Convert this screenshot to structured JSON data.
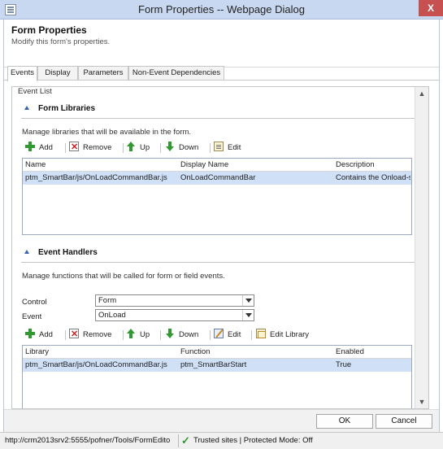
{
  "window": {
    "title": "Form Properties -- Webpage Dialog",
    "close_label": "X"
  },
  "header": {
    "title": "Form Properties",
    "subtitle": "Modify this form's properties."
  },
  "tabs": [
    {
      "label": "Events",
      "active": true
    },
    {
      "label": "Display",
      "active": false
    },
    {
      "label": "Parameters",
      "active": false
    },
    {
      "label": "Non-Event Dependencies",
      "active": false
    }
  ],
  "event_list": {
    "legend": "Event List",
    "form_libraries": {
      "title": "Form Libraries",
      "description": "Manage libraries that will be available in the form.",
      "toolbar": {
        "add": "Add",
        "remove": "Remove",
        "up": "Up",
        "down": "Down",
        "edit": "Edit"
      },
      "columns": [
        "Name",
        "Display Name",
        "Description"
      ],
      "rows": [
        {
          "name": "ptm_SmartBar/js/OnLoadCommandBar.js",
          "display_name": "OnLoadCommandBar",
          "description": "Contains the Onload-s..."
        }
      ]
    },
    "event_handlers": {
      "title": "Event Handlers",
      "description": "Manage functions that will be called for form or field events.",
      "control_label": "Control",
      "control_value": "Form",
      "event_label": "Event",
      "event_value": "OnLoad",
      "toolbar": {
        "add": "Add",
        "remove": "Remove",
        "up": "Up",
        "down": "Down",
        "edit": "Edit",
        "edit_library": "Edit Library"
      },
      "columns": [
        "Library",
        "Function",
        "Enabled"
      ],
      "rows": [
        {
          "library": "ptm_SmartBar/js/OnLoadCommandBar.js",
          "function": "ptm_SmartBarStart",
          "enabled": "True"
        }
      ]
    }
  },
  "footer": {
    "ok": "OK",
    "cancel": "Cancel"
  },
  "statusbar": {
    "url": "http://crm2013srv2:5555/pofner/Tools/FormEdito",
    "zone": "Trusted sites | Protected Mode: Off"
  },
  "colors": {
    "titlebar": "#c9d8f1",
    "close": "#c75050",
    "selected_row": "#cfe0f7",
    "section_triangle": "#3a62b0"
  }
}
